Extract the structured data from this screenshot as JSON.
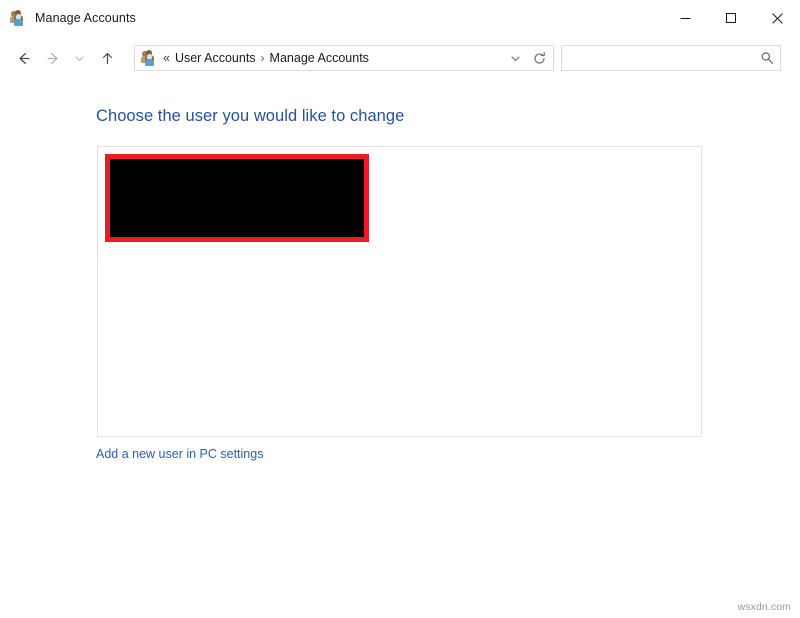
{
  "window": {
    "title": "Manage Accounts",
    "icon": "users-icon",
    "controls": {
      "minimize": "Minimize",
      "maximize": "Maximize",
      "close": "Close"
    }
  },
  "toolbar": {
    "back": "Back",
    "forward": "Forward",
    "recent_locations": "Recent locations",
    "up": "Up to User Accounts",
    "address": {
      "icon": "users-icon",
      "overflow": "«",
      "crumbs": [
        {
          "label": "User Accounts"
        },
        {
          "label": "Manage Accounts"
        }
      ],
      "separator": "›",
      "dropdown": "Previous locations",
      "refresh": "Refresh"
    },
    "search": {
      "value": "",
      "placeholder": "",
      "icon": "search-icon"
    }
  },
  "main": {
    "heading": "Choose the user you would like to change",
    "user_list": {
      "redacted": true,
      "redaction_label": "redacted-user-account"
    },
    "add_user_link": "Add a new user in PC settings"
  },
  "watermark": "wsxdn.com",
  "colors": {
    "heading_blue": "#27519c",
    "link_blue": "#2b5fa8",
    "redaction_border": "#ed1c24",
    "redaction_fill": "#000000",
    "panel_border": "#e3e3e3"
  }
}
